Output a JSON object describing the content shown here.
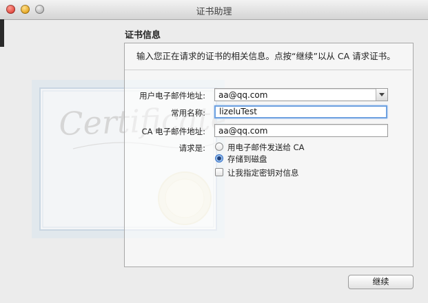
{
  "window": {
    "title": "证书助理"
  },
  "section_title": "证书信息",
  "instruction": "输入您正在请求的证书的相关信息。点按“继续”以从 CA 请求证书。",
  "art": {
    "certificate_word": "Certificate"
  },
  "form": {
    "user_email": {
      "label": "用户电子邮件地址:",
      "value": "aa@qq.com"
    },
    "common_name": {
      "label": "常用名称:",
      "value": "lizeluTest"
    },
    "ca_email": {
      "label": "CA 电子邮件地址:",
      "value": "aa@qq.com"
    },
    "request_label": "请求是:",
    "options": [
      {
        "label": "用电子邮件发送给 CA",
        "selected": false
      },
      {
        "label": "存储到磁盘",
        "selected": true
      }
    ],
    "key_pair": {
      "label": "让我指定密钥对信息",
      "checked": false
    }
  },
  "buttons": {
    "continue": "继续"
  },
  "colors": {
    "focus_ring": "#6ea1e0",
    "radio_selected": "#5d98e0"
  }
}
